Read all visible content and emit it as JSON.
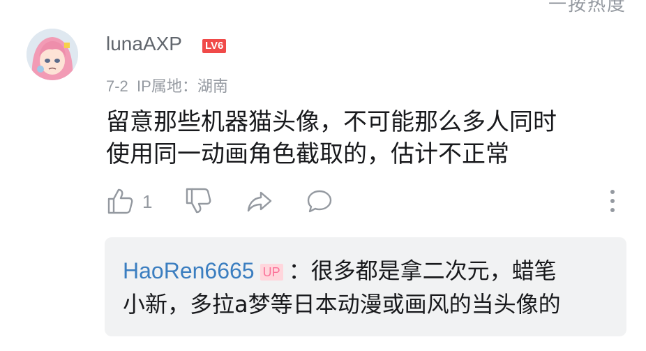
{
  "top": {
    "partial_text": "一按热度"
  },
  "comment": {
    "username": "lunaAXP",
    "level": "LV6",
    "date": "7-2",
    "ip_location": "IP属地：湖南",
    "text_line1": "留意那些机器猫头像，不可能那么多人同时",
    "text_line2": "使用同一动画角色截取的，估计不正常",
    "like_count": "1"
  },
  "reply": {
    "username": "HaoRen6665",
    "badge": "UP",
    "colon": "：",
    "text_line1": "很多都是拿二次元，蜡笔",
    "text_line2": "小新，多拉a梦等日本动漫或画风的当头像的"
  },
  "colors": {
    "accent_blue": "#3b7ec0",
    "level_red": "#f04a49",
    "up_pink": "#fb7299",
    "muted": "#9499a0"
  },
  "icons": [
    "like-icon",
    "dislike-icon",
    "share-icon",
    "comment-icon",
    "more-icon"
  ]
}
